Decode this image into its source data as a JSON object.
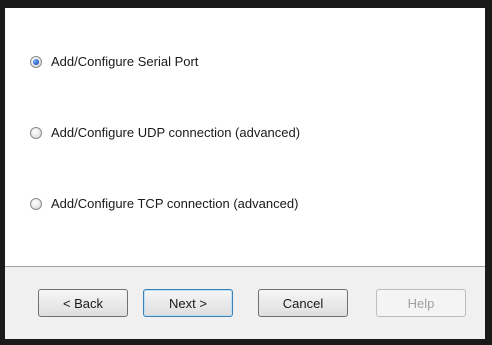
{
  "options": [
    {
      "label": "Add/Configure Serial Port",
      "checked": true
    },
    {
      "label": "Add/Configure UDP connection (advanced)",
      "checked": false
    },
    {
      "label": "Add/Configure TCP connection (advanced)",
      "checked": false
    }
  ],
  "buttons": {
    "back": "< Back",
    "next": "Next >",
    "cancel": "Cancel",
    "help": "Help"
  },
  "colors": {
    "frame": "#1a1a1a",
    "footer_bg": "#f0f0f0",
    "radio_selected": "#2a63c7",
    "default_button_border": "#3c7fb1"
  }
}
